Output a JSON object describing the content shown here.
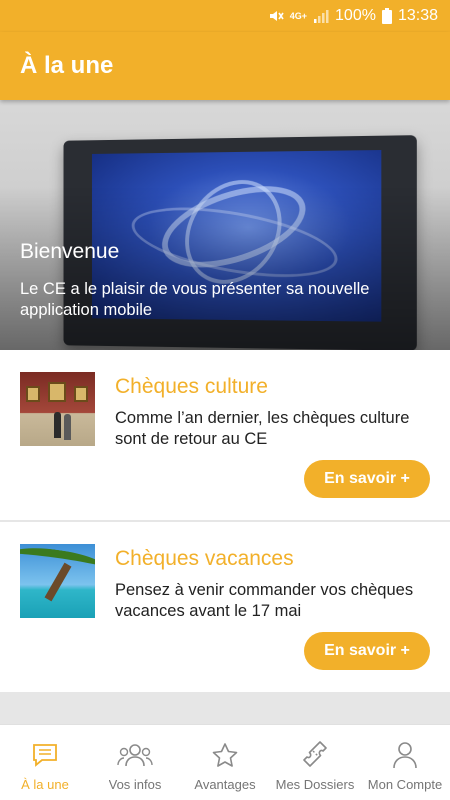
{
  "status_bar": {
    "network": "4G+",
    "battery": "100%",
    "time": "13:38",
    "icons": [
      "mute-icon",
      "signal-icon",
      "battery-icon"
    ]
  },
  "app_bar": {
    "title": "À la une"
  },
  "hero": {
    "title": "Bienvenue",
    "text": "Le CE a le plaisir de vous présenter sa nouvelle application mobile"
  },
  "cards": [
    {
      "title": "Chèques culture",
      "description": "Comme l’an dernier, les chèques culture sont de retour au CE",
      "button": "En savoir +",
      "image": "museum-image"
    },
    {
      "title": "Chèques vacances",
      "description": "Pensez à venir commander vos chèques vacances avant le 17 mai",
      "button": "En savoir +",
      "image": "beach-image"
    }
  ],
  "bottom_nav": {
    "active_index": 0,
    "accent_color": "#f2b02a",
    "items": [
      {
        "label": "À la une",
        "icon": "news-icon"
      },
      {
        "label": "Vos infos",
        "icon": "people-icon"
      },
      {
        "label": "Avantages",
        "icon": "star-icon"
      },
      {
        "label": "Mes Dossiers",
        "icon": "ticket-icon"
      },
      {
        "label": "Mon Compte",
        "icon": "account-icon"
      }
    ]
  }
}
